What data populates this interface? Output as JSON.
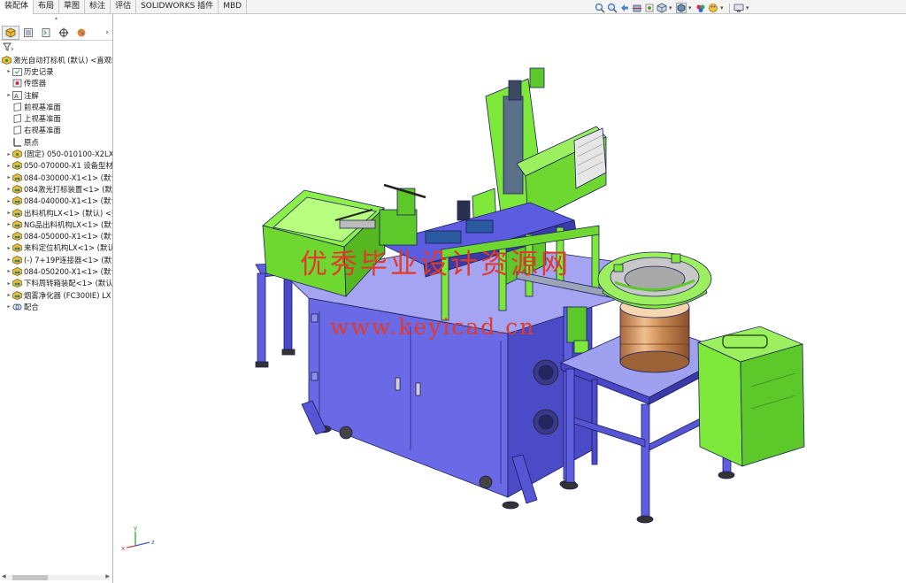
{
  "command_tabs": [
    "装配体",
    "布局",
    "草图",
    "标注",
    "评估",
    "SOLIDWORKS 插件",
    "MBD"
  ],
  "active_tab": 0,
  "hud_icons": [
    "zoom-fit-icon",
    "zoom-area-icon",
    "previous-view-icon",
    "section-view-icon",
    "dynamic-annotation-icon",
    "view-orientation-icon",
    "display-style-icon",
    "hide-show-items-icon",
    "edit-appearance-icon",
    "apply-scene-icon",
    "view-settings-icon"
  ],
  "panel_tabs": [
    "feature-manager-icon",
    "property-manager-icon",
    "configuration-manager-icon",
    "dimxpert-icon",
    "display-manager-icon"
  ],
  "panel_more": "›",
  "panel_grip": "•",
  "tree": {
    "root": "激光自动打标机 (默认) <直观S",
    "items": [
      {
        "label": "历史记录",
        "icon": "history-folder-icon",
        "expandable": true
      },
      {
        "label": "传感器",
        "icon": "sensor-icon",
        "expandable": false
      },
      {
        "label": "注解",
        "icon": "annotation-icon",
        "expandable": true
      },
      {
        "label": "前视基准面",
        "icon": "plane-icon",
        "expandable": false
      },
      {
        "label": "上视基准面",
        "icon": "plane-icon",
        "expandable": false
      },
      {
        "label": "右视基准面",
        "icon": "plane-icon",
        "expandable": false
      },
      {
        "label": "原点",
        "icon": "origin-icon",
        "expandable": false
      },
      {
        "label": "(固定) 050-010100-X2LX-",
        "icon": "part-icon",
        "expandable": true
      },
      {
        "label": "050-070000-X1 设备型材",
        "icon": "subassembly-icon",
        "expandable": true
      },
      {
        "label": "084-030000-X1<1> (默认",
        "icon": "subassembly-icon",
        "expandable": true
      },
      {
        "label": "084激光打标装置<1> (默认",
        "icon": "subassembly-icon",
        "expandable": true
      },
      {
        "label": "084-040000-X1<1> (默认",
        "icon": "subassembly-icon",
        "expandable": true
      },
      {
        "label": "出料机构LX<1> (默认) <数",
        "icon": "subassembly-icon",
        "expandable": true
      },
      {
        "label": "NG品出料机构LX<1> (默认",
        "icon": "subassembly-icon",
        "expandable": true
      },
      {
        "label": "084-050000-X1<1> (默认",
        "icon": "subassembly-icon",
        "expandable": true
      },
      {
        "label": "来料定位机构LX<1> (默认",
        "icon": "subassembly-icon",
        "expandable": true
      },
      {
        "label": "(-) 7+19P连接器<1> (默认",
        "icon": "subassembly-icon",
        "expandable": true
      },
      {
        "label": "084-050200-X1<1> (默认",
        "icon": "subassembly-icon",
        "expandable": true
      },
      {
        "label": "下料周转箱装配<1> (默认)",
        "icon": "subassembly-icon",
        "expandable": true
      },
      {
        "label": "烟雾净化器 (FC300IE) LX",
        "icon": "subassembly-icon",
        "expandable": true
      },
      {
        "label": "配合",
        "icon": "mates-icon",
        "expandable": true
      }
    ]
  },
  "watermark": {
    "line1": "优秀毕业设计资源网",
    "line2": "www.keyicad.cn"
  },
  "triad_labels": {
    "x": "x",
    "y": "y",
    "z": "z"
  },
  "colors": {
    "frame_blue": "#5e5ee0",
    "table_light": "#a0a0f0",
    "green": "#7ee83a",
    "bronze": "#c88a55",
    "watermark": "#e23a2a"
  }
}
